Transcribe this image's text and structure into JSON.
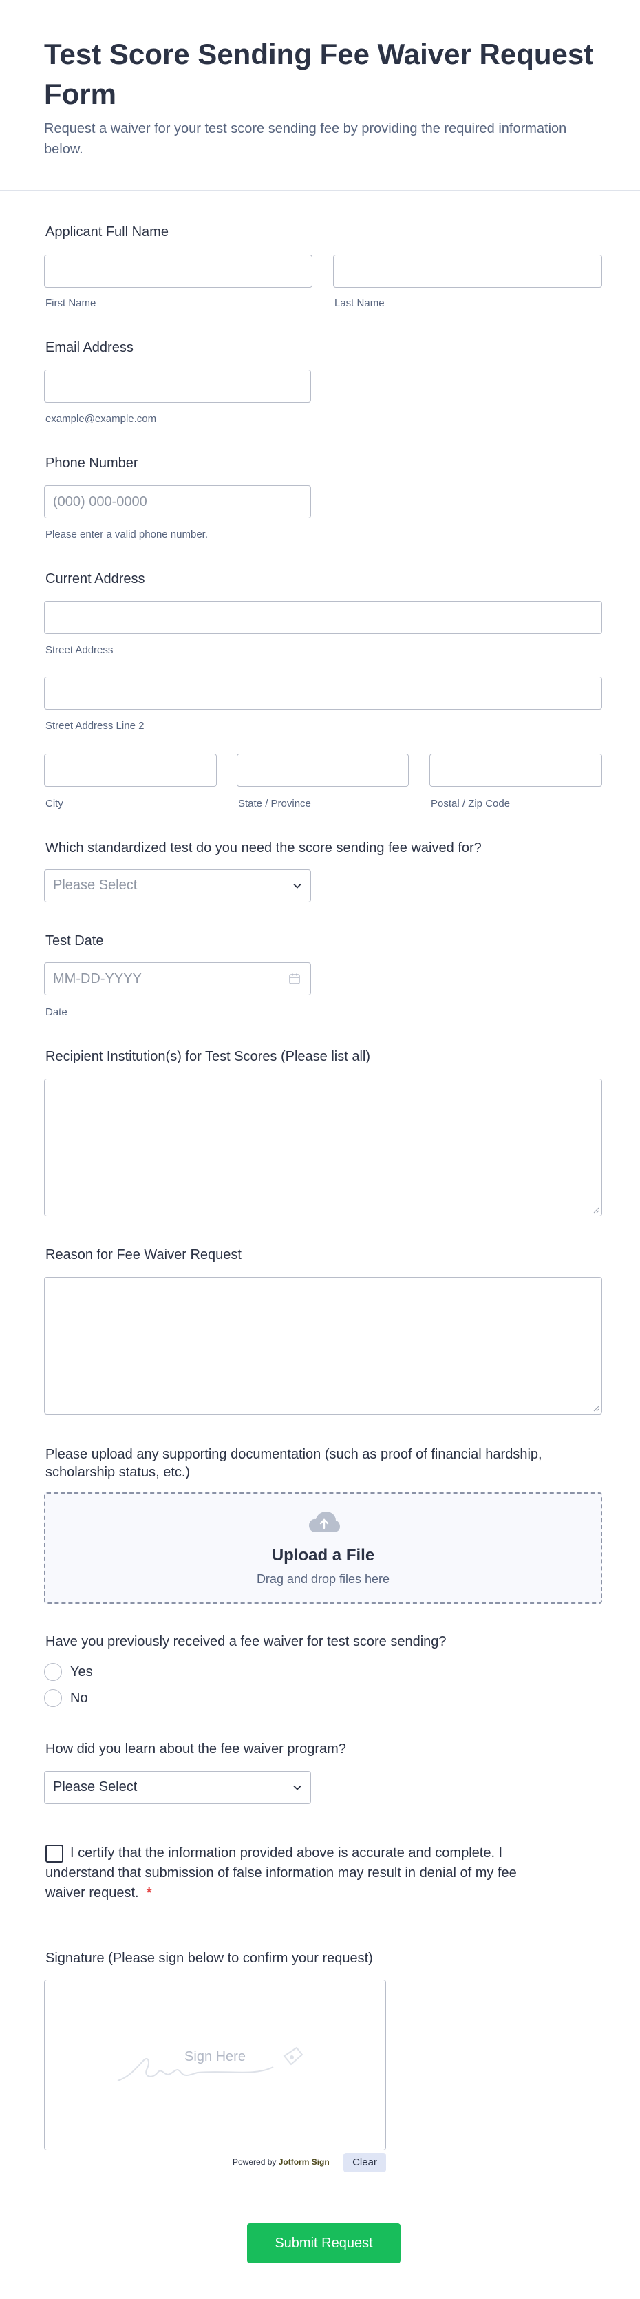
{
  "form": {
    "title": "Test Score Sending Fee Waiver Request Form",
    "subtitle": "Request a waiver for your test score sending fee by providing the required information below."
  },
  "name": {
    "label": "Applicant Full Name",
    "first_sublabel": "First Name",
    "last_sublabel": "Last Name"
  },
  "email": {
    "label": "Email Address",
    "sublabel": "example@example.com"
  },
  "phone": {
    "label": "Phone Number",
    "placeholder": "(000) 000-0000",
    "sublabel": "Please enter a valid phone number."
  },
  "address": {
    "label": "Current Address",
    "street_sublabel": "Street Address",
    "street2_sublabel": "Street Address Line 2",
    "city_sublabel": "City",
    "state_sublabel": "State / Province",
    "postal_sublabel": "Postal / Zip Code"
  },
  "test": {
    "label": "Which standardized test do you need the score sending fee waived for?",
    "selected": "Please Select"
  },
  "test_date": {
    "label": "Test Date",
    "placeholder": "MM-DD-YYYY",
    "sublabel": "Date"
  },
  "recipients": {
    "label": "Recipient Institution(s) for Test Scores (Please list all)"
  },
  "reason": {
    "label": "Reason for Fee Waiver Request"
  },
  "upload": {
    "label": "Please upload any supporting documentation (such as proof of financial hardship, scholarship status, etc.)",
    "title": "Upload a File",
    "subtitle": "Drag and drop files here"
  },
  "previous": {
    "label": "Have you previously received a fee waiver for test score sending?",
    "options": [
      "Yes",
      "No"
    ]
  },
  "learn": {
    "label": "How did you learn about the fee waiver program?",
    "selected": "Please Select"
  },
  "consent": {
    "text": "I certify that the information provided above is accurate and complete. I understand that submission of false information may result in denial of my fee waiver request.",
    "required_mark": "*"
  },
  "signature": {
    "label": "Signature (Please sign below to confirm your request)",
    "placeholder": "Sign Here",
    "powered_prefix": "Powered by",
    "powered_brand": "Jotform Sign",
    "clear_label": "Clear"
  },
  "submit": {
    "label": "Submit Request"
  },
  "colors": {
    "submit": "#18bd5b",
    "text": "#2c3345",
    "sublabel": "#57647e",
    "border": "#b8bdc9",
    "required": "#e54b4b"
  }
}
